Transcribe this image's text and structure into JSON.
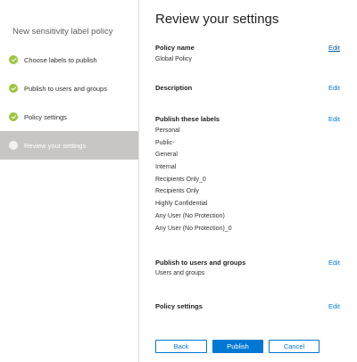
{
  "wizard": {
    "title": "New sensitivity label policy",
    "steps": [
      {
        "label": "Choose labels to publish",
        "status": "done"
      },
      {
        "label": "Publish to users and groups",
        "status": "done"
      },
      {
        "label": "Policy settings",
        "status": "done"
      },
      {
        "label": "Review your settings",
        "status": "current"
      }
    ]
  },
  "main": {
    "title": "Review your settings",
    "sections": {
      "policy_name": {
        "title": "Policy name",
        "value": "Global Policy",
        "edit": "Edit"
      },
      "description": {
        "title": "Description",
        "edit": "Edit"
      },
      "labels": {
        "title": "Publish these labels",
        "edit": "Edit",
        "items": [
          "Personal",
          "Public-",
          "General",
          "Internal",
          "Recipients Only_0",
          "Recipients Only",
          "Highly Confidential",
          "Any User (No Protection)",
          "Any User (No Protection)_0"
        ]
      },
      "users_groups": {
        "title": "Publish to users and groups",
        "value": "Users and groups",
        "edit": "Edit"
      },
      "policy_settings": {
        "title": "Policy settings",
        "edit": "Edit"
      }
    }
  },
  "buttons": {
    "back": "Back",
    "publish": "Publish",
    "cancel": "Cancel"
  },
  "colors": {
    "accent": "#0078d4",
    "done": "#9bc53c",
    "active_step_bg": "#c8c6c4"
  }
}
